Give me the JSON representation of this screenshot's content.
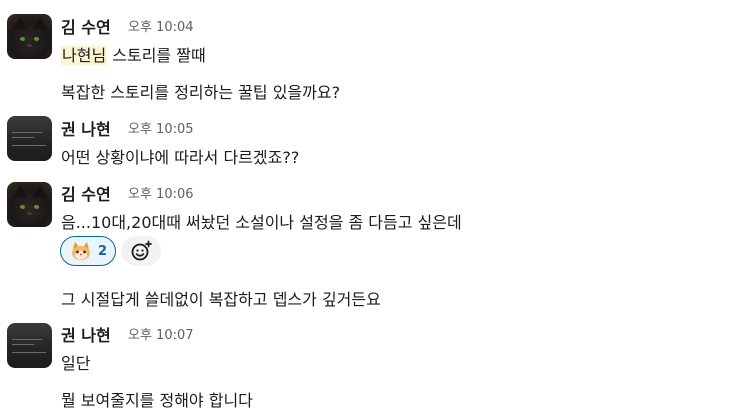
{
  "messages": [
    {
      "author": "김 수연",
      "time": "오후 10:04",
      "lines": [
        {
          "highlight": "나현님",
          "rest": " 스토리를 짤때"
        },
        "복잡한 스토리를 정리하는 꿀팁 있을까요?"
      ]
    },
    {
      "author": "권 나현",
      "time": "오후 10:05",
      "lines": [
        "어떤 상황이냐에 따라서 다르겠죠??"
      ]
    },
    {
      "author": "김 수연",
      "time": "오후 10:06",
      "lines": [
        "음...10대,20대때 써놨던 소설이나 설정을 좀 다듬고 싶은데",
        "그 시절답게 쓸데없이 복잡하고 뎁스가 깊거든요"
      ],
      "reaction": {
        "emoji": "cat-face-emoji",
        "count": "2"
      },
      "add_reaction_icon": "add-reaction-icon"
    },
    {
      "author": "권 나현",
      "time": "오후 10:07",
      "lines": [
        "일단",
        "뭘 보여줄지를 정해야 합니다"
      ]
    }
  ],
  "colors": {
    "text": "#1d1c1d",
    "timestamp": "#616061",
    "mention_highlight": "#fdf3d0",
    "reaction_border": "#1264a3",
    "reaction_bg": "#e8f5fa"
  }
}
